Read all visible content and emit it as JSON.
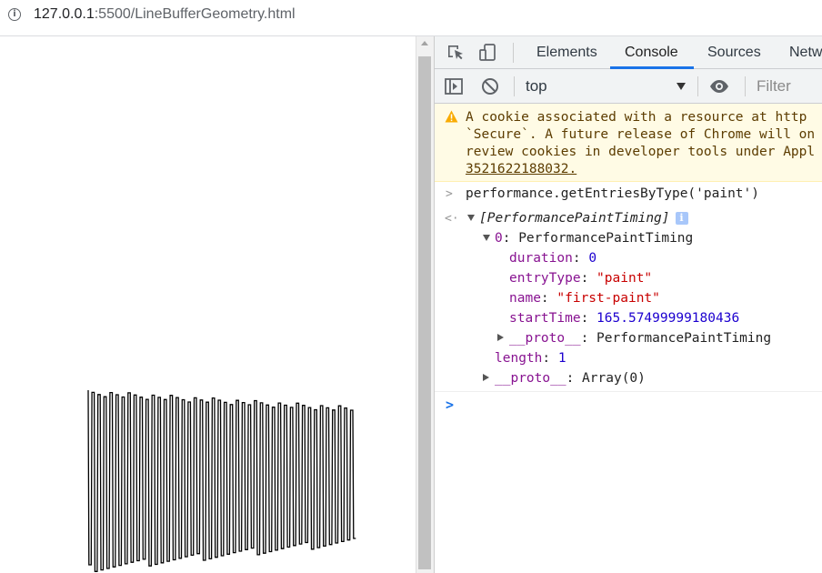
{
  "browser": {
    "url_host": "127.0.0.1",
    "url_rest": ":5500/LineBufferGeometry.html"
  },
  "devtools": {
    "tabs": [
      {
        "label": "Elements"
      },
      {
        "label": "Console"
      },
      {
        "label": "Sources"
      },
      {
        "label": "Netw"
      }
    ],
    "active_tab": "Console",
    "context": "top",
    "filter_placeholder": "Filter"
  },
  "console": {
    "warning_lines": [
      "A cookie associated with a resource at http",
      "`Secure`. A future release of Chrome will on",
      "review cookies in developer tools under Appl",
      "3521622188032."
    ],
    "command": "performance.getEntriesByType('paint')",
    "result": {
      "array_summary": "[PerformancePaintTiming]",
      "entry_label": "0",
      "entry_type": "PerformancePaintTiming",
      "properties": [
        {
          "key": "duration",
          "value": "0",
          "kind": "num"
        },
        {
          "key": "entryType",
          "value": "\"paint\"",
          "kind": "str"
        },
        {
          "key": "name",
          "value": "\"first-paint\"",
          "kind": "str"
        },
        {
          "key": "startTime",
          "value": "165.57499999180436",
          "kind": "num"
        }
      ],
      "inner_proto_key": "__proto__",
      "inner_proto_value": "PerformancePaintTiming",
      "length_key": "length",
      "length_value": "1",
      "outer_proto_key": "__proto__",
      "outer_proto_value": "Array(0)"
    }
  },
  "colors": {
    "accent": "#1a73e8",
    "warning_bg": "#fffbe5",
    "warning_text": "#5c3c00",
    "key": "#881391",
    "string": "#c80000",
    "number": "#1c00cf"
  }
}
